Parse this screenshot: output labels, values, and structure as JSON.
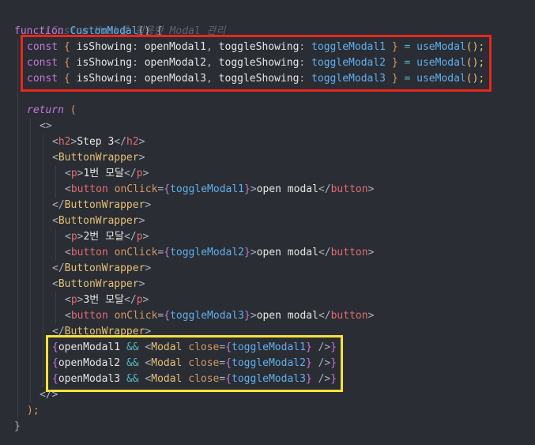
{
  "code": {
    "comment": "//Custom Hook를 활용한 Modal 관리",
    "fn_keyword": "function",
    "fn_name": "CustomModal",
    "fn_params": "() {",
    "const_kw": "const",
    "hook_lines": [
      {
        "open": "{",
        "key1": "isShowing",
        "colon1": ":",
        "val1": "openModal1",
        "comma": ",",
        "key2": "toggleShowing",
        "colon2": ":",
        "val2": "toggleModal1",
        "close": "}",
        "eq": "=",
        "call": "useModal",
        "parens": "();"
      },
      {
        "open": "{",
        "key1": "isShowing",
        "colon1": ":",
        "val1": "openModal2",
        "comma": ",",
        "key2": "toggleShowing",
        "colon2": ":",
        "val2": "toggleModal2",
        "close": "}",
        "eq": "=",
        "call": "useModal",
        "parens": "();"
      },
      {
        "open": "{",
        "key1": "isShowing",
        "colon1": ":",
        "val1": "openModal3",
        "comma": ",",
        "key2": "toggleShowing",
        "colon2": ":",
        "val2": "toggleModal3",
        "close": "}",
        "eq": "=",
        "call": "useModal",
        "parens": "();"
      }
    ],
    "return_kw": "return",
    "return_paren": "(",
    "frag_open": "<>",
    "frag_close": "</>",
    "h2_open": "<h2>",
    "h2_text": "Step 3",
    "h2_close": "</h2>",
    "wrapper_open": "<ButtonWrapper>",
    "wrapper_close": "</ButtonWrapper>",
    "p_open": "<p>",
    "p_close": "</p>",
    "button_open": "<button",
    "onclick_attr": "onClick=",
    "button_close": "</button>",
    "button_text": "open modal",
    "groups": [
      {
        "p_text": "1번 모달",
        "handler": "toggleModal1"
      },
      {
        "p_text": "2번 모달",
        "handler": "toggleModal2"
      },
      {
        "p_text": "3번 모달",
        "handler": "toggleModal3"
      }
    ],
    "modal_lines": [
      {
        "cond": "openModal1",
        "handler": "toggleModal1"
      },
      {
        "cond": "openModal2",
        "handler": "toggleModal2"
      },
      {
        "cond": "openModal3",
        "handler": "toggleModal3"
      }
    ],
    "and_op": "&&",
    "modal_tag": "Modal",
    "close_attr": "close=",
    "self_close": "/>",
    "return_end": ");",
    "fn_end": "}"
  },
  "colors": {
    "background": "#2a2d33",
    "highlight_red": "#e8271f",
    "highlight_yellow": "#f5e23a"
  }
}
